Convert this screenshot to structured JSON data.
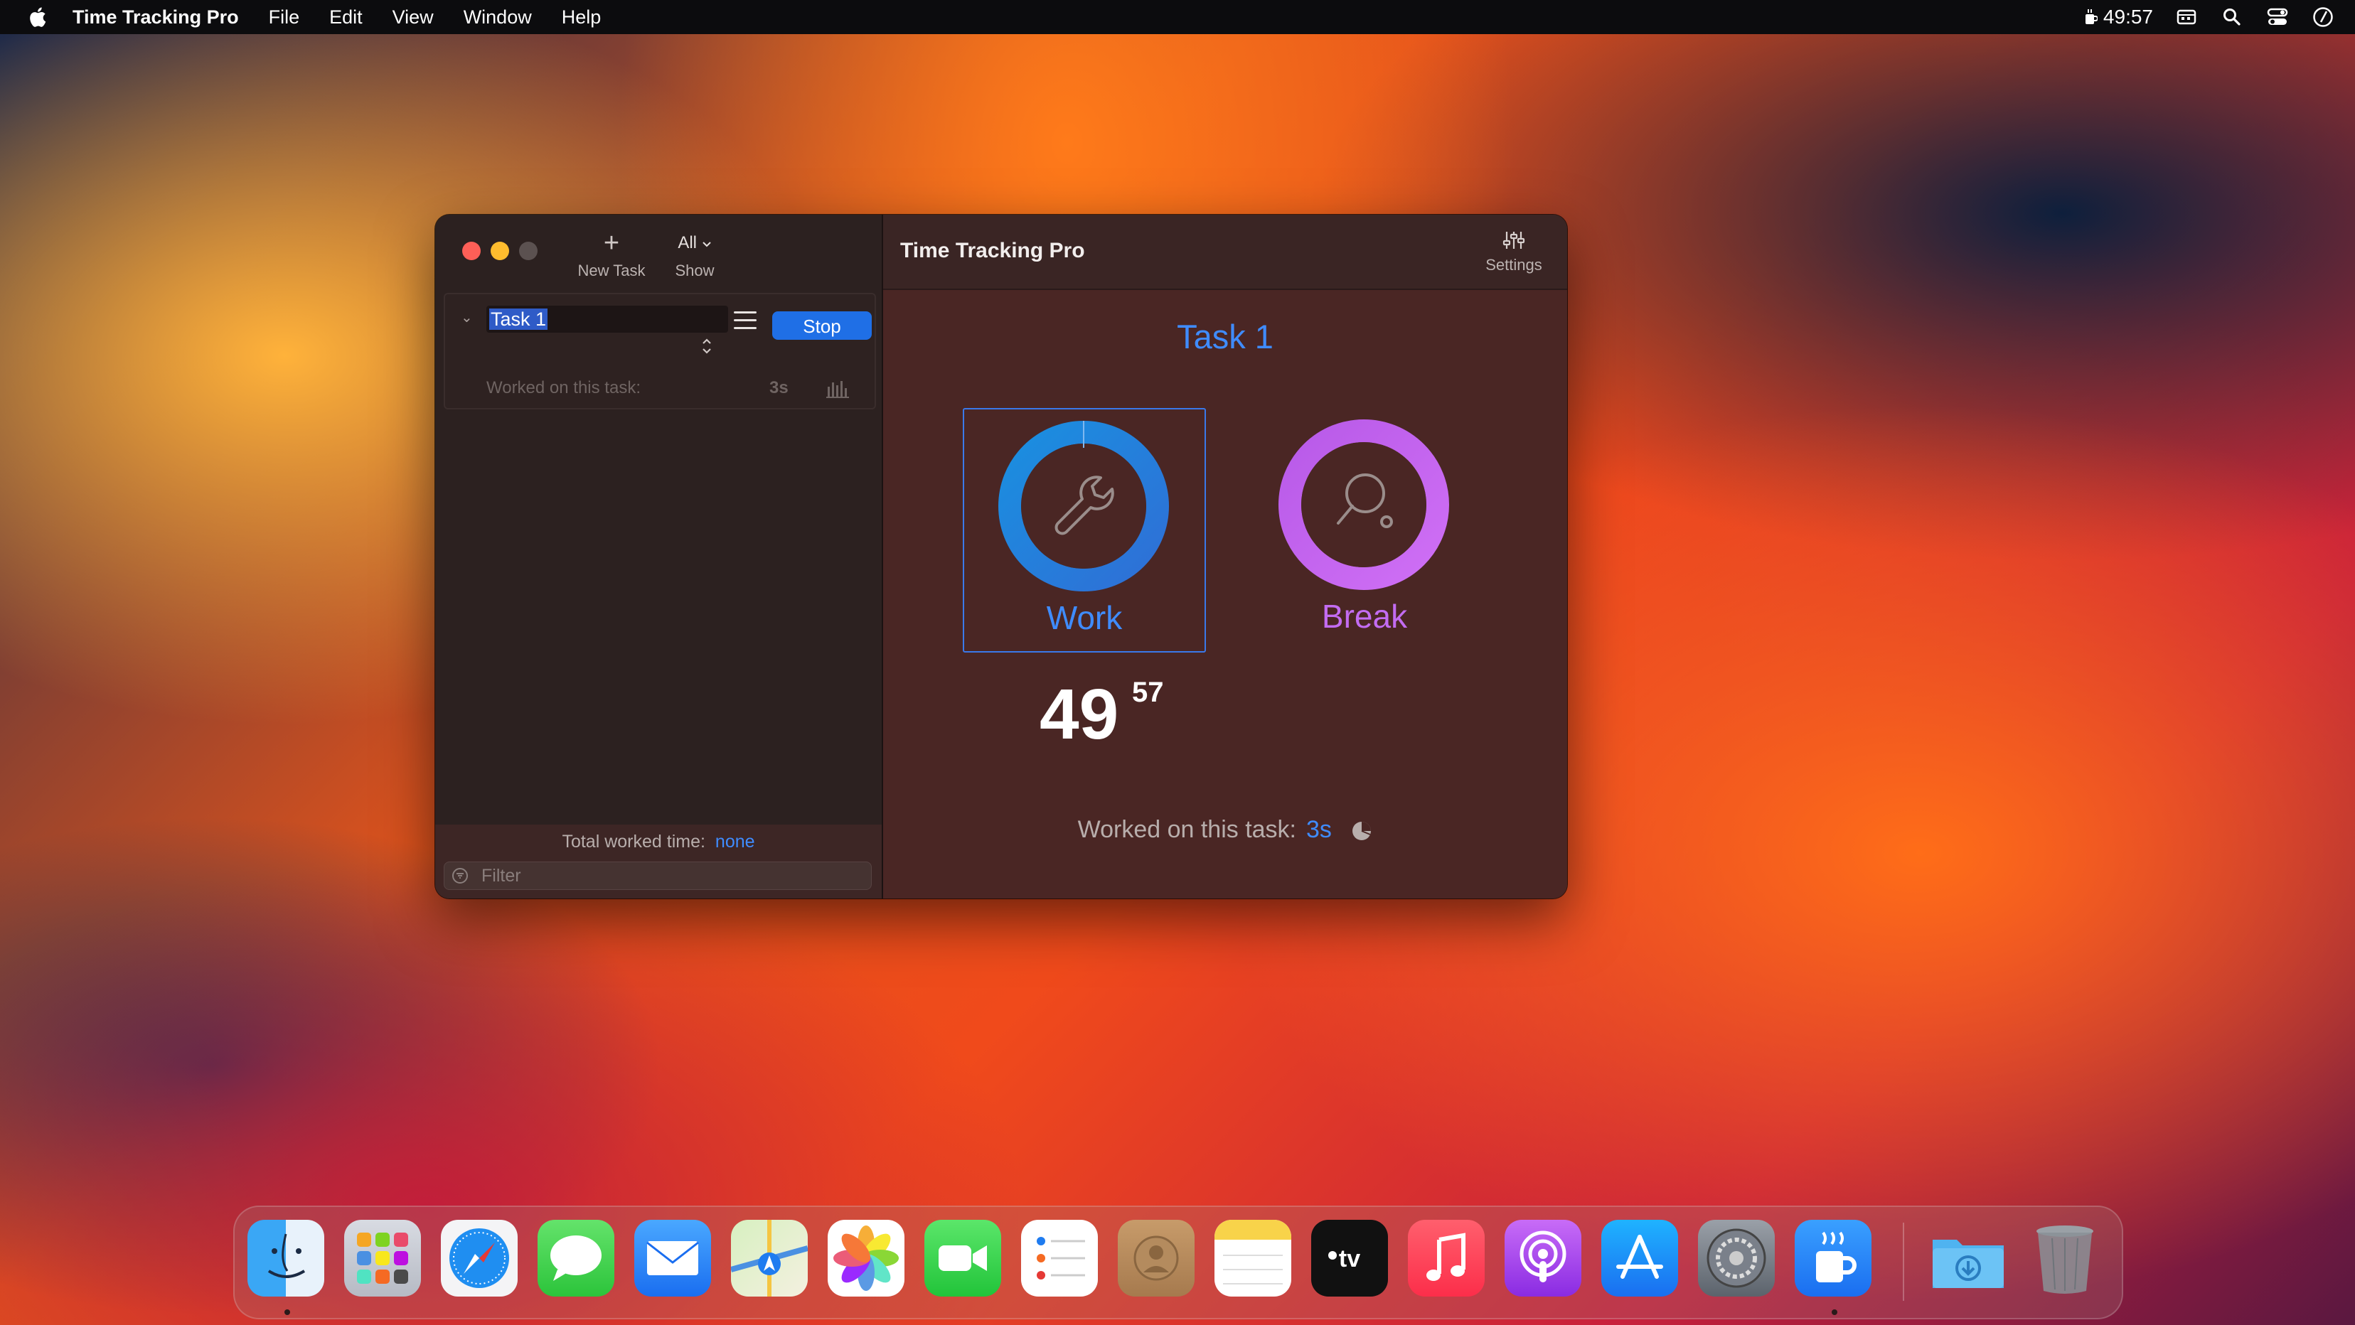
{
  "menubar": {
    "app_name": "Time Tracking Pro",
    "menus": [
      "File",
      "Edit",
      "View",
      "Window",
      "Help"
    ],
    "status_time": "49:57"
  },
  "sidebar": {
    "new_task_label": "New Task",
    "show_label": "Show",
    "show_value": "All",
    "task": {
      "name": "Task 1",
      "stop_label": "Stop",
      "worked_label": "Worked on this task:",
      "worked_value": "3s"
    },
    "total_label": "Total worked time:",
    "total_value": "none",
    "filter_placeholder": "Filter"
  },
  "main": {
    "title": "Time Tracking Pro",
    "settings_label": "Settings",
    "current_task": "Task 1",
    "modes": [
      {
        "label": "Work",
        "icon": "wrench-icon",
        "color": "#3f8cff"
      },
      {
        "label": "Break",
        "icon": "ping-pong-icon",
        "color": "#c36cf2"
      }
    ],
    "timer_minutes": "49",
    "timer_seconds": "57",
    "worked_label": "Worked on this task:",
    "worked_value": "3s"
  },
  "dock": {
    "apps": [
      "Finder",
      "Launchpad",
      "Safari",
      "Messages",
      "Mail",
      "Maps",
      "Photos",
      "FaceTime",
      "Reminders",
      "Contacts",
      "Notes",
      "TV",
      "Music",
      "Podcasts",
      "App Store",
      "System Settings",
      "Time Tracking Pro",
      "Downloads",
      "Trash"
    ]
  }
}
